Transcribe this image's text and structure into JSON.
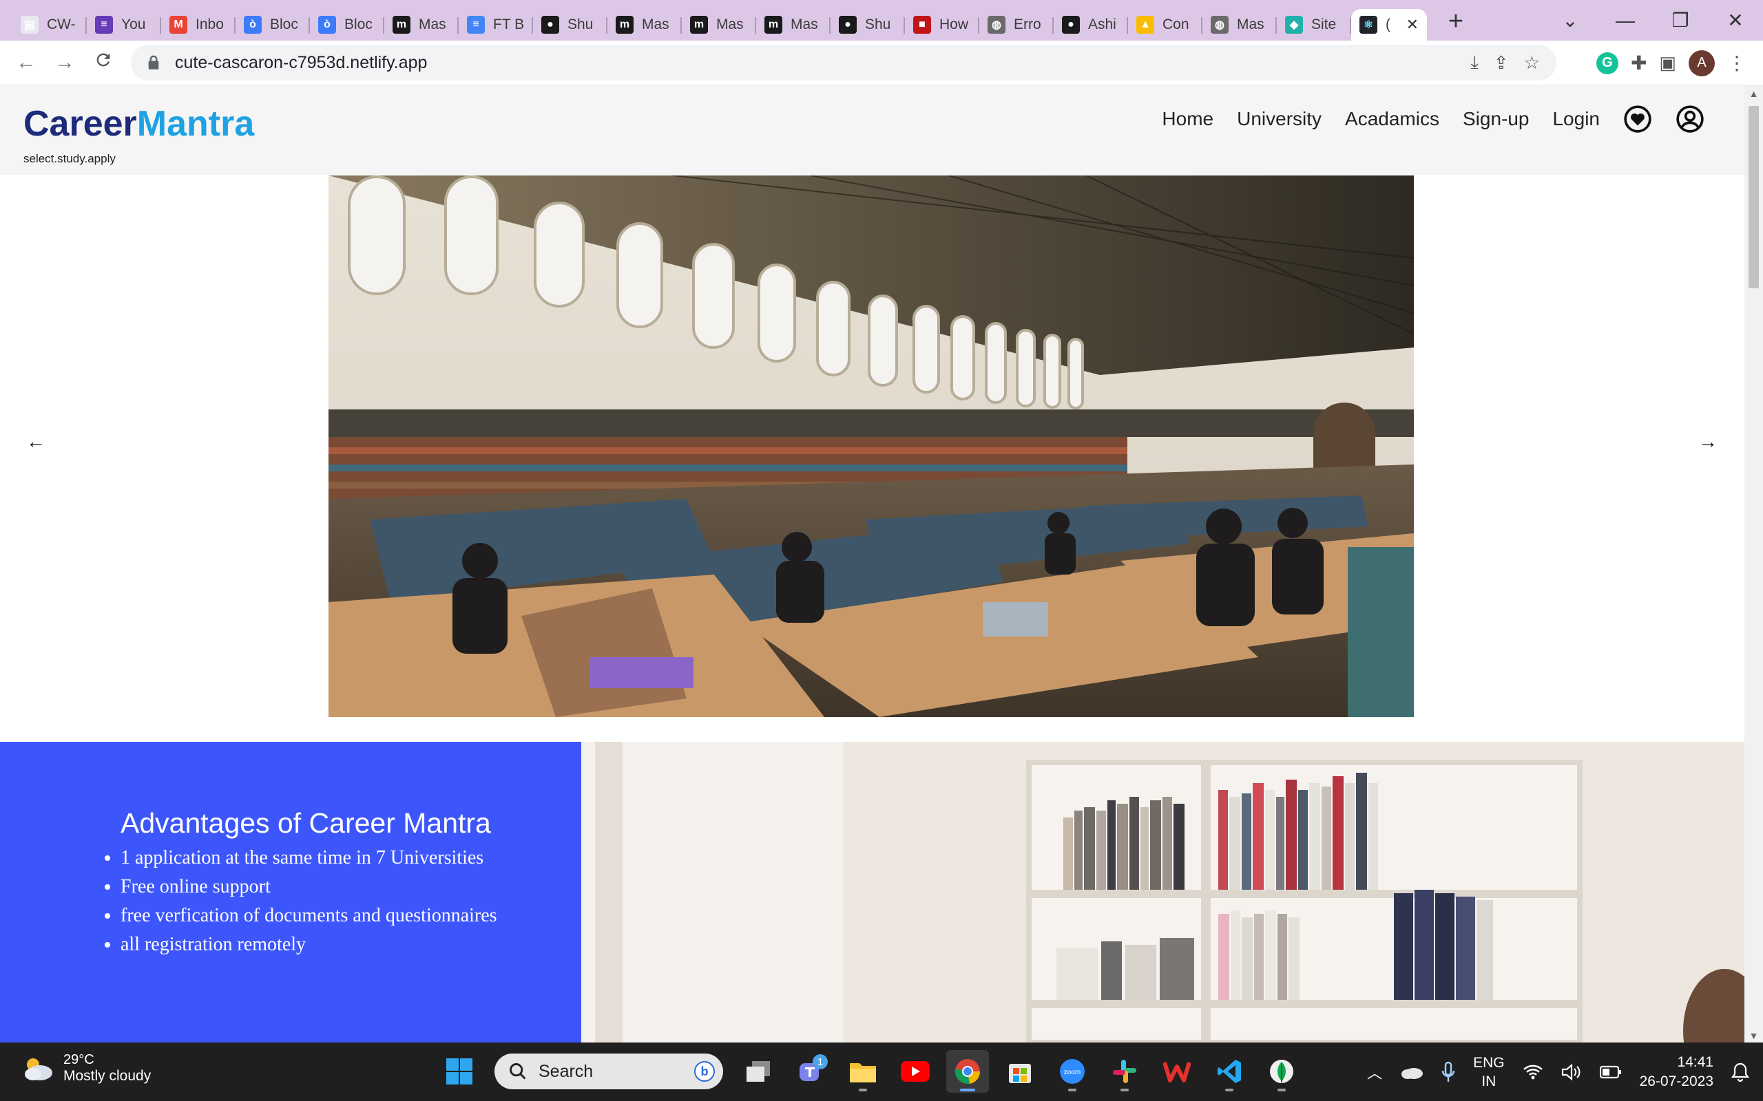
{
  "browser": {
    "tabs": [
      {
        "title": "CW-",
        "icon": "doc-icon",
        "color": "#e8e8ee"
      },
      {
        "title": "You",
        "icon": "forms-icon",
        "color": "#673ab7"
      },
      {
        "title": "Inbo",
        "icon": "gmail-icon",
        "color": "#ea4335"
      },
      {
        "title": "Bloc",
        "icon": "blockchain-icon",
        "color": "#3e7bfa"
      },
      {
        "title": "Bloc",
        "icon": "blockchain-icon",
        "color": "#3e7bfa"
      },
      {
        "title": "Mas",
        "icon": "masai-icon",
        "color": "#1a1a1a"
      },
      {
        "title": "FT B",
        "icon": "docs-icon",
        "color": "#4285f4"
      },
      {
        "title": "Shu",
        "icon": "github-icon",
        "color": "#1a1a1a"
      },
      {
        "title": "Mas",
        "icon": "masai-icon",
        "color": "#1a1a1a"
      },
      {
        "title": "Mas",
        "icon": "masai-icon",
        "color": "#1a1a1a"
      },
      {
        "title": "Mas",
        "icon": "masai-icon",
        "color": "#1a1a1a"
      },
      {
        "title": "Shu",
        "icon": "github-icon",
        "color": "#1a1a1a"
      },
      {
        "title": "How",
        "icon": "flag-icon",
        "color": "#c0161a"
      },
      {
        "title": "Erro",
        "icon": "globe-icon",
        "color": "#6a6a6a"
      },
      {
        "title": "Ashi",
        "icon": "github-icon",
        "color": "#1a1a1a"
      },
      {
        "title": "Con",
        "icon": "drive-icon",
        "color": "#fbbc04"
      },
      {
        "title": "Mas",
        "icon": "globe-icon",
        "color": "#6a6a6a"
      },
      {
        "title": "Site",
        "icon": "netlify-icon",
        "color": "#20b2aa"
      }
    ],
    "active_tab": {
      "title": "(",
      "icon": "react-icon",
      "close": "✕"
    },
    "new_tab": "+",
    "window_controls": {
      "dropdown": "⌄",
      "minimize": "—",
      "restore": "❐",
      "close": "✕"
    },
    "url": "cute-cascaron-c7953d.netlify.app",
    "profile_initial": "A",
    "grammarly": "G"
  },
  "site": {
    "logo_part1": "Career",
    "logo_part2": "Mantra",
    "tagline": "select.study.apply",
    "nav": [
      "Home",
      "University",
      "Acadamics",
      "Sign-up",
      "Login"
    ],
    "carousel_prev": "←",
    "carousel_next": "→",
    "advantages": {
      "heading": "Advantages of Career Mantra",
      "items": [
        "1 application at the same time in 7 Universities",
        "Free online support",
        "free verfication of documents and questionnaires",
        "all registration remotely"
      ]
    },
    "colors": {
      "logo_dark": "#1e2a7a",
      "logo_light": "#1ea2e4",
      "advantages_bg": "#3d56fb"
    }
  },
  "taskbar": {
    "temperature": "29°C",
    "condition": "Mostly cloudy",
    "search_placeholder": "Search",
    "teams_badge": "1",
    "language_top": "ENG",
    "language_bottom": "IN",
    "time": "14:41",
    "date": "26-07-2023"
  }
}
